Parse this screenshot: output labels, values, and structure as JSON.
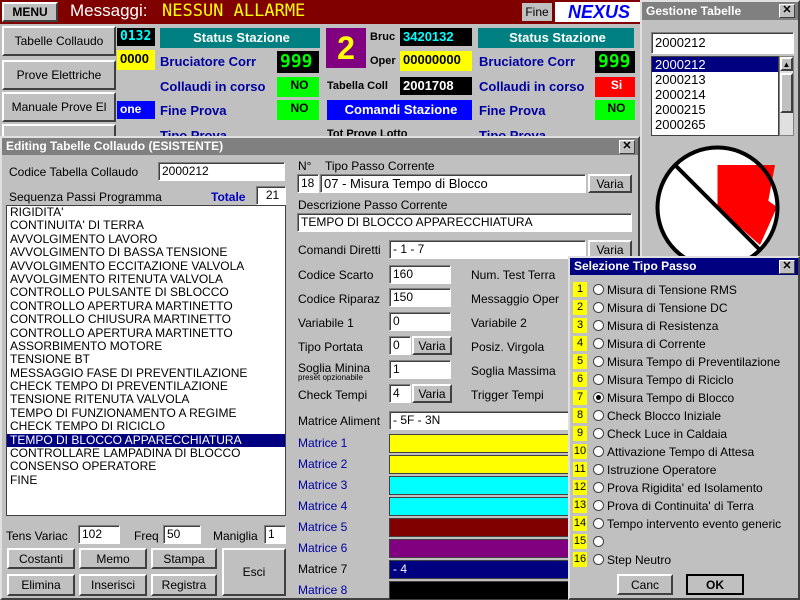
{
  "topbar": {
    "menu_label": "MENU",
    "messages_label": "Messaggi:",
    "messages_value": "NESSUN ALLARME",
    "fine_label": "Fine",
    "brand": "NEXUS"
  },
  "left_nav": {
    "tabelle": "Tabelle Collaudo",
    "prove_elettriche": "Prove Elettriche",
    "manuale": "Manuale Prove El"
  },
  "station_panel": {
    "code_partial": "0132",
    "code_partial2": "0000",
    "status_label": "Status Stazione",
    "bruciatore_label": "Bruciatore Corr",
    "bruciatore_value": "999",
    "collaudi_label": "Collaudi in corso",
    "collaudi_value": "NO",
    "fine_prova_partial": "one",
    "fine_prova_label": "Fine Prova",
    "fine_prova_value": "NO",
    "tipo_prova_partial": "Tipo Prova"
  },
  "station2": {
    "number": "2",
    "bruc_label": "Bruc",
    "bruc_value": "3420132",
    "oper_label": "Oper",
    "oper_value": "00000000",
    "tabella_label": "Tabella Coll",
    "tabella_value": "2001708",
    "status_label": "Status Stazione",
    "bruciatore_label": "Bruciatore Corr",
    "bruciatore_value": "999",
    "collaudi_label": "Collaudi in corso",
    "collaudi_value": "Si",
    "comandi_label": "Comandi Stazione",
    "fine_prova_label": "Fine Prova",
    "fine_prova_value": "NO",
    "tot_prove_partial": "Tot Prove Lotto",
    "tipo_prova_partial": "Tipo Prova"
  },
  "gestione": {
    "title": "Gestione Tabelle",
    "search_value": "2000212",
    "items": [
      "2000212",
      "2000213",
      "2000214",
      "2000215",
      "2000265"
    ]
  },
  "editing": {
    "title": "Editing Tabelle Collaudo (ESISTENTE)",
    "codice_label": "Codice Tabella Collaudo",
    "codice_value": "2000212",
    "sequenza_label": "Sequenza Passi Programma",
    "totale_label": "Totale",
    "totale_value": "21",
    "steps": [
      "RIGIDITA'",
      "CONTINUITA' DI TERRA",
      "AVVOLGIMENTO LAVORO",
      "AVVOLGIMENTO DI BASSA TENSIONE",
      "AVVOLGIMENTO ECCITAZIONE VALVOLA",
      "AVVOLGIMENTO RITENUTA VALVOLA",
      "CONTROLLO PULSANTE DI SBLOCCO",
      "CONTROLLO APERTURA MARTINETTO",
      "CONTROLLO CHIUSURA MARTINETTO",
      "CONTROLLO APERTURA MARTINETTO",
      "ASSORBIMENTO MOTORE",
      "TENSIONE BT",
      "MESSAGGIO FASE DI PREVENTILAZIONE",
      "CHECK TEMPO DI PREVENTILAZIONE",
      "TENSIONE RITENUTA VALVOLA",
      "TEMPO DI FUNZIONAMENTO A REGIME",
      "CHECK TEMPO DI RICICLO",
      "TEMPO DI BLOCCO APPARECCHIATURA",
      "CONTROLLARE LAMPADINA DI BLOCCO",
      "CONSENSO OPERATORE",
      "FINE"
    ],
    "selected_step": 17,
    "tens_variac_label": "Tens Variac",
    "tens_variac_value": "102",
    "freq_label": "Freq",
    "freq_value": "50",
    "maniglia_label": "Maniglia",
    "maniglia_value": "1",
    "buttons": {
      "costanti": "Costanti",
      "memo": "Memo",
      "stampa": "Stampa",
      "esci": "Esci",
      "elimina": "Elimina",
      "inserisci": "Inserisci",
      "registra": "Registra"
    },
    "n_label": "N°",
    "tipo_passo_label": "Tipo Passo Corrente",
    "n_value": "18",
    "tipo_passo_value": "07 - Misura Tempo di Blocco",
    "varia_label": "Varia",
    "descrizione_label": "Descrizione Passo Corrente",
    "descrizione_value": "TEMPO DI BLOCCO APPARECCHIATURA",
    "comandi_label": "Comandi Diretti",
    "comandi_value": "- 1 - 7",
    "codice_scarto_label": "Codice Scarto",
    "codice_scarto_value": "160",
    "num_test_label": "Num. Test Terra",
    "codice_riparaz_label": "Codice Riparaz",
    "codice_riparaz_value": "150",
    "messaggio_oper_label": "Messaggio Oper",
    "variabile1_label": "Variabile 1",
    "variabile1_value": "0",
    "variabile2_label": "Variabile 2",
    "tipo_portata_label": "Tipo Portata",
    "tipo_portata_value": "0",
    "posiz_virgola_label": "Posiz. Virgola",
    "soglia_minima_label": "Soglia Minina",
    "soglia_minima_sub": "preset opzionabile",
    "soglia_minima_value": "1",
    "soglia_massima_label": "Soglia Massima",
    "check_tempi_label": "Check Tempi",
    "check_tempi_value": "4",
    "trigger_tempi_label": "Trigger Tempi",
    "matrice_aliment_label": "Matrice Aliment",
    "matrice_aliment_value": "- 5F - 3N",
    "matrices": [
      {
        "label": "Matrice 1",
        "color": "#ffff00",
        "text": ""
      },
      {
        "label": "Matrice 2",
        "color": "#ffff00",
        "text": ""
      },
      {
        "label": "Matrice 3",
        "color": "#00ffff",
        "text": ""
      },
      {
        "label": "Matrice 4",
        "color": "#00ffff",
        "text": ""
      },
      {
        "label": "Matrice 5",
        "color": "#800000",
        "text": ""
      },
      {
        "label": "Matrice 6",
        "color": "#800080",
        "text": ""
      },
      {
        "label": "Matrice 7",
        "color": "#000080",
        "text": "- 4"
      },
      {
        "label": "Matrice 8",
        "color": "#000000",
        "text": ""
      }
    ]
  },
  "selezione": {
    "title": "Selezione Tipo Passo",
    "options": [
      {
        "n": "1",
        "label": "Misura di Tensione RMS"
      },
      {
        "n": "2",
        "label": "Misura di Tensione DC"
      },
      {
        "n": "3",
        "label": "Misura di Resistenza"
      },
      {
        "n": "4",
        "label": "Misura di Corrente"
      },
      {
        "n": "5",
        "label": "Misura Tempo di Preventilazione"
      },
      {
        "n": "6",
        "label": "Misura Tempo di Riciclo"
      },
      {
        "n": "7",
        "label": "Misura Tempo di Blocco"
      },
      {
        "n": "8",
        "label": "Check Blocco Iniziale"
      },
      {
        "n": "9",
        "label": "Check Luce in Caldaia"
      },
      {
        "n": "10",
        "label": "Attivazione Tempo di Attesa"
      },
      {
        "n": "11",
        "label": "Istruzione Operatore"
      },
      {
        "n": "12",
        "label": "Prova Rigidita' ed Isolamento"
      },
      {
        "n": "13",
        "label": "Prova di Continuita' di Terra"
      },
      {
        "n": "14",
        "label": "Tempo intervento evento generic"
      },
      {
        "n": "15",
        "label": ""
      },
      {
        "n": "16",
        "label": "Step Neutro"
      }
    ],
    "selected_index": 6,
    "cancel_label": "Canc",
    "ok_label": "OK"
  },
  "colors": {
    "topbar_bg": "#800000",
    "messages_value": "#ffff00",
    "brand": "#0000ff",
    "selection": "#000080",
    "badge": "#ffff00"
  }
}
